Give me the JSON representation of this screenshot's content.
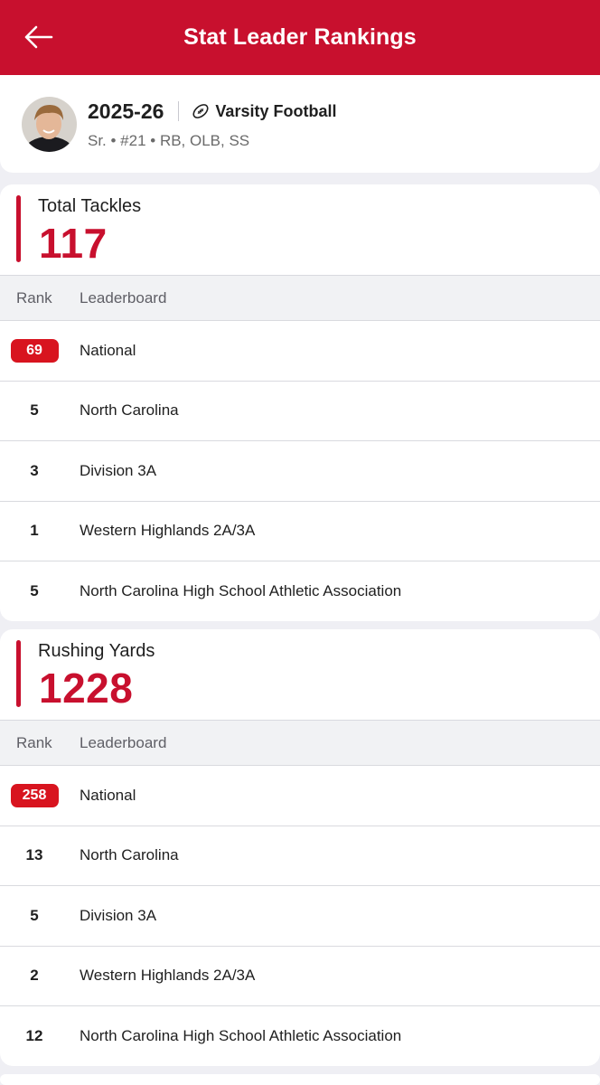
{
  "header": {
    "title": "Stat Leader Rankings"
  },
  "profile": {
    "season": "2025-26",
    "sport": "Varsity Football",
    "details": "Sr. • #21 • RB, OLB, SS"
  },
  "table_headers": {
    "rank": "Rank",
    "leaderboard": "Leaderboard"
  },
  "stats": [
    {
      "label": "Total Tackles",
      "value": "117",
      "rows": [
        {
          "rank": "69",
          "board": "National"
        },
        {
          "rank": "5",
          "board": "North Carolina"
        },
        {
          "rank": "3",
          "board": "Division 3A"
        },
        {
          "rank": "1",
          "board": "Western Highlands 2A/3A"
        },
        {
          "rank": "5",
          "board": "North Carolina High School Athletic Association"
        }
      ]
    },
    {
      "label": "Rushing Yards",
      "value": "1228",
      "rows": [
        {
          "rank": "258",
          "board": "National"
        },
        {
          "rank": "13",
          "board": "North Carolina"
        },
        {
          "rank": "5",
          "board": "Division 3A"
        },
        {
          "rank": "2",
          "board": "Western Highlands 2A/3A"
        },
        {
          "rank": "12",
          "board": "North Carolina High School Athletic Association"
        }
      ]
    }
  ],
  "colors": {
    "brand": "#c8102e",
    "badge": "#d8141f"
  },
  "icons": {
    "back": "arrow-left-icon",
    "sport": "football-icon"
  }
}
